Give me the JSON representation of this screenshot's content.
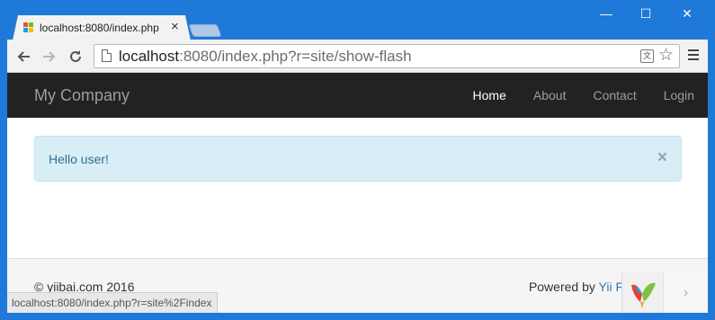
{
  "browser": {
    "tab": {
      "title": "localhost:8080/index.php",
      "close_glyph": "×"
    },
    "window_controls": {
      "minimize": "—",
      "maximize": "☐",
      "close": "✕"
    },
    "address": {
      "host": "localhost",
      "rest": ":8080/index.php?r=site/show-flash"
    },
    "icons": {
      "back": "back-arrow-icon",
      "forward": "forward-arrow-icon",
      "reload": "reload-icon",
      "page": "page-icon",
      "translate": "translate-icon",
      "star": "star-icon",
      "menu": "menu-icon"
    },
    "status_url": "localhost:8080/index.php?r=site%2Findex"
  },
  "page": {
    "brand": "My Company",
    "nav": [
      {
        "label": "Home",
        "active": true
      },
      {
        "label": "About",
        "active": false
      },
      {
        "label": "Contact",
        "active": false
      },
      {
        "label": "Login",
        "active": false
      }
    ],
    "alert": {
      "message": "Hello user!",
      "close_glyph": "×",
      "type": "info"
    },
    "footer": {
      "copyright": "© yiibai.com 2016",
      "powered_prefix": "Powered by ",
      "powered_link": "Yii F"
    },
    "scroll_next_glyph": "›"
  },
  "colors": {
    "window_frame": "#1f79d8",
    "navbar_bg": "#222222",
    "nav_text": "#9d9d9d",
    "nav_active": "#ffffff",
    "alert_bg": "#d9edf7",
    "alert_border": "#bce8f1",
    "alert_text": "#31708f",
    "link": "#337ab7",
    "footer_bg": "#f5f5f5"
  }
}
